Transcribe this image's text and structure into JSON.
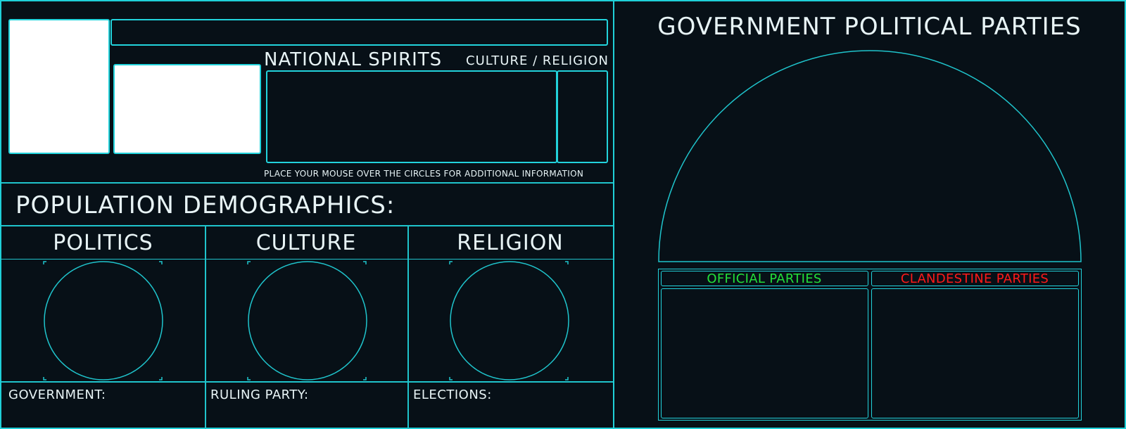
{
  "left": {
    "national_spirits": "NATIONAL SPIRITS",
    "culture_religion": "CULTURE / RELIGION",
    "hint": "PLACE YOUR MOUSE OVER THE CIRCLES FOR ADDITIONAL INFORMATION",
    "demographics_title": "POPULATION DEMOGRAPHICS:",
    "columns": [
      {
        "title": "POLITICS",
        "footer": "GOVERNMENT:"
      },
      {
        "title": "CULTURE",
        "footer": "RULING PARTY:"
      },
      {
        "title": "RELIGION",
        "footer": "ELECTIONS:"
      }
    ]
  },
  "right": {
    "title": "GOVERNMENT POLITICAL PARTIES",
    "official": "OFFICIAL PARTIES",
    "clandestine": "CLANDESTINE PARTIES"
  },
  "colors": {
    "accent": "#1fd0d8",
    "background": "#071017",
    "official": "#22e03a",
    "clandestine": "#ff1a1a"
  }
}
